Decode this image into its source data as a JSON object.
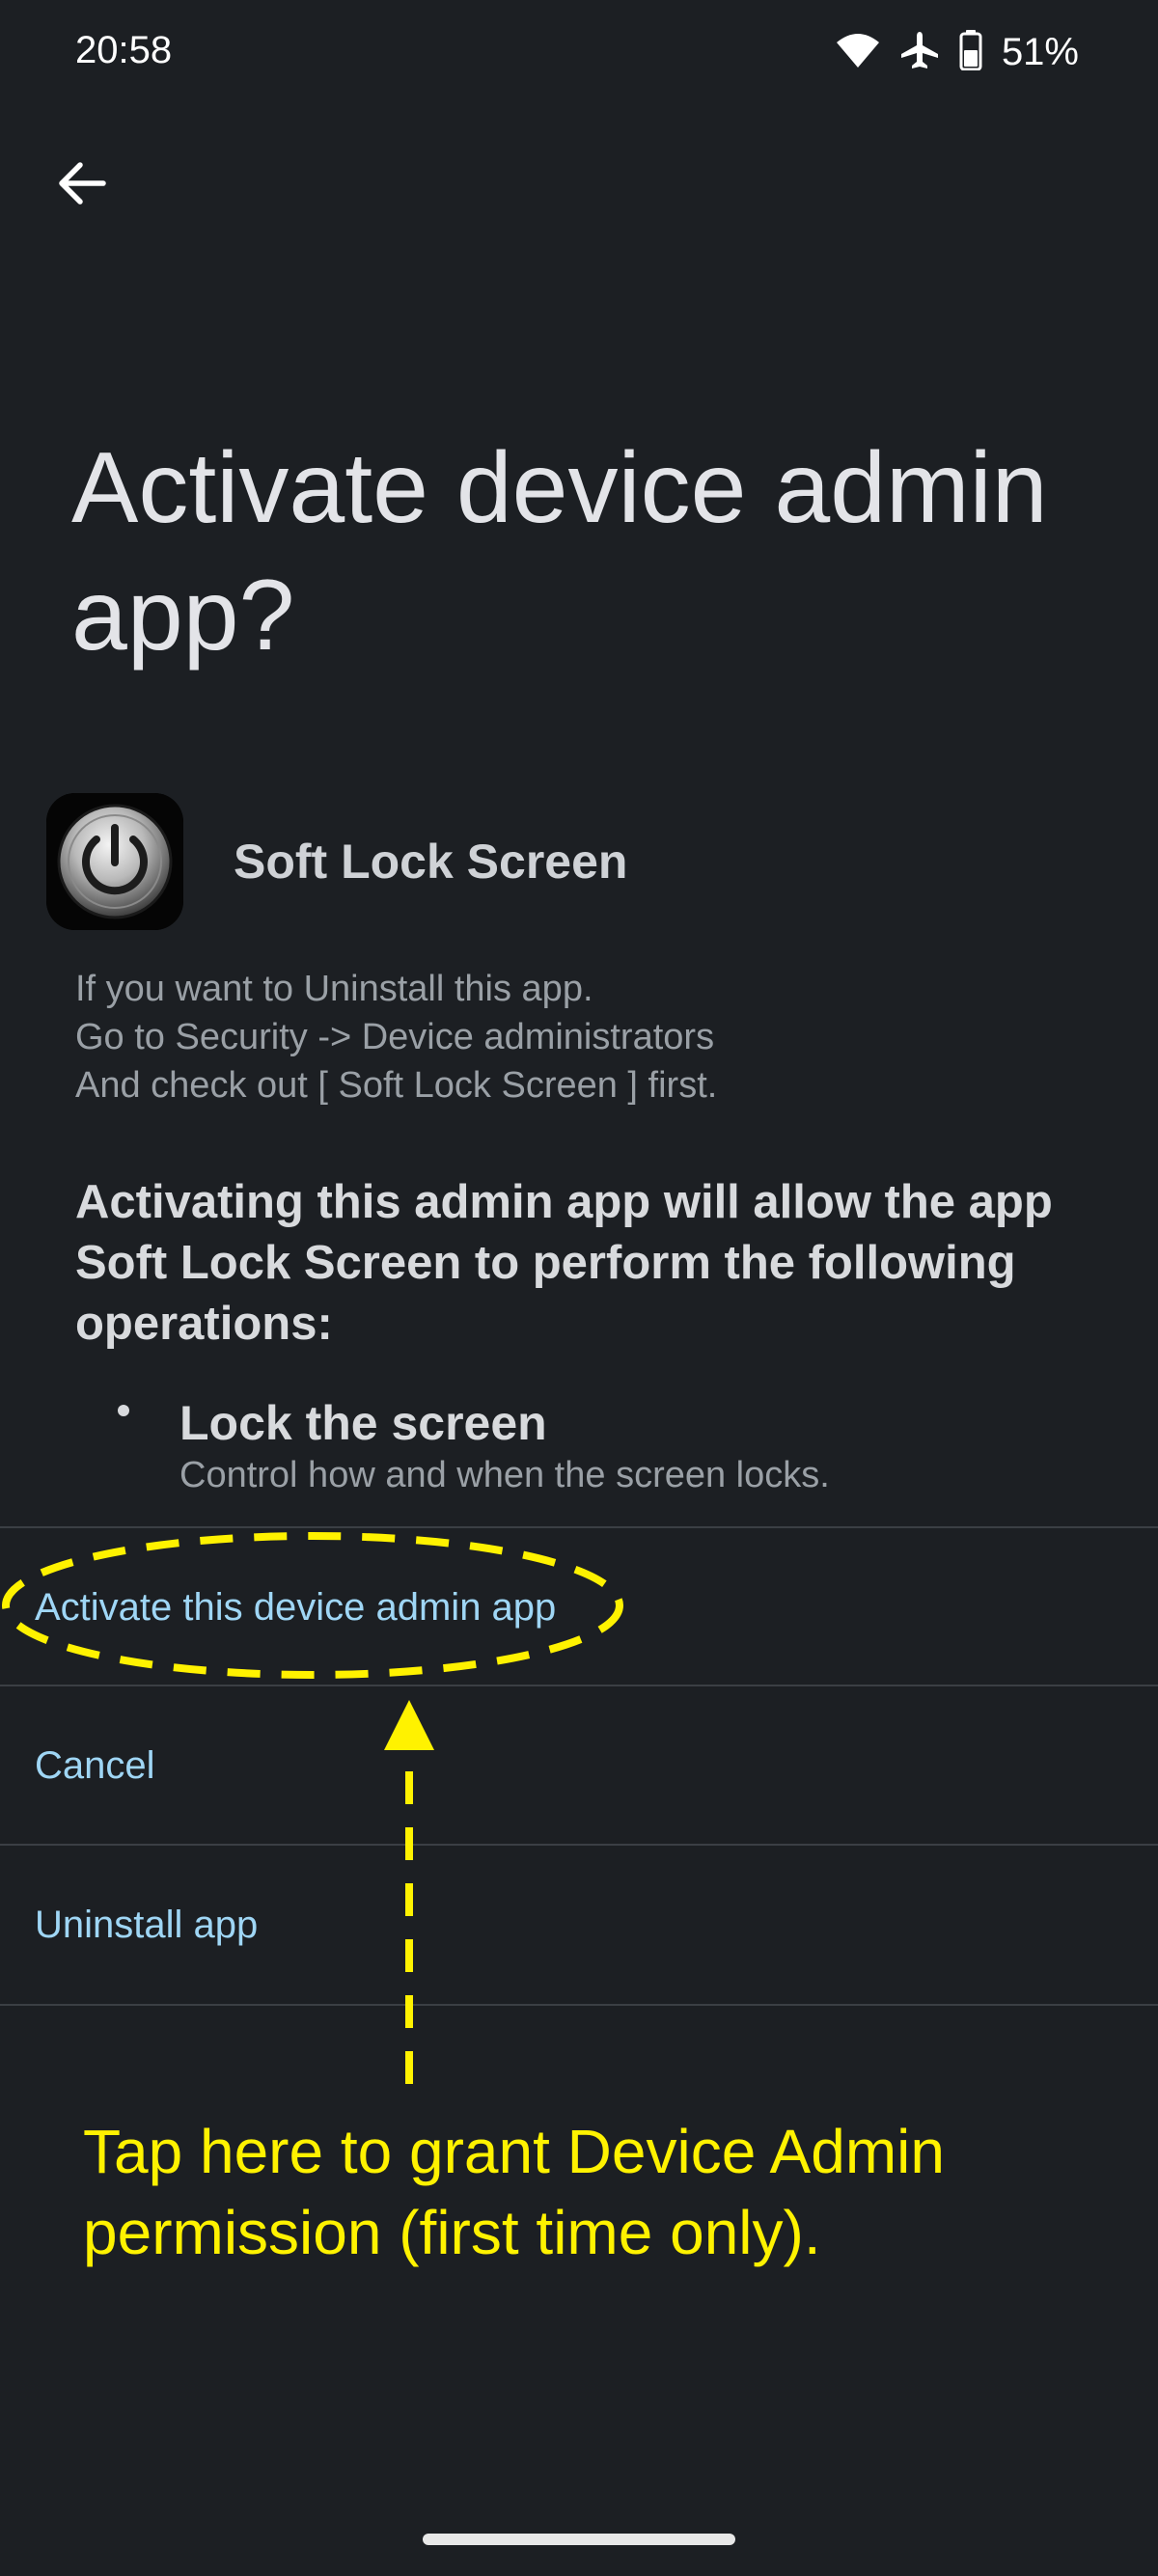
{
  "status_bar": {
    "time": "20:58",
    "battery": "51%",
    "icons": [
      "wifi-icon",
      "airplane-mode-icon",
      "battery-icon"
    ]
  },
  "header": {
    "back_icon": "arrow-left-icon",
    "title": "Activate device admin app?"
  },
  "app": {
    "name": "Soft Lock Screen",
    "icon": "power-icon",
    "description_lines": [
      "If you want to Uninstall this app.",
      "Go to Security -> Device administrators",
      "And check out [ Soft Lock Screen ] first."
    ]
  },
  "warning": "Activating this admin app will allow the app Soft Lock Screen to perform the following operations:",
  "permissions": [
    {
      "title": "Lock the screen",
      "description": "Control how and when the screen locks."
    }
  ],
  "actions": [
    {
      "label": "Activate this device admin app"
    },
    {
      "label": "Cancel"
    },
    {
      "label": "Uninstall app"
    }
  ],
  "annotation": {
    "text": "Tap here to grant Device Admin permission (first time only).",
    "color": "#fff200"
  },
  "colors": {
    "background": "#1c1f23",
    "accent_link": "#9fd6f5",
    "divider": "#3b3f44"
  }
}
